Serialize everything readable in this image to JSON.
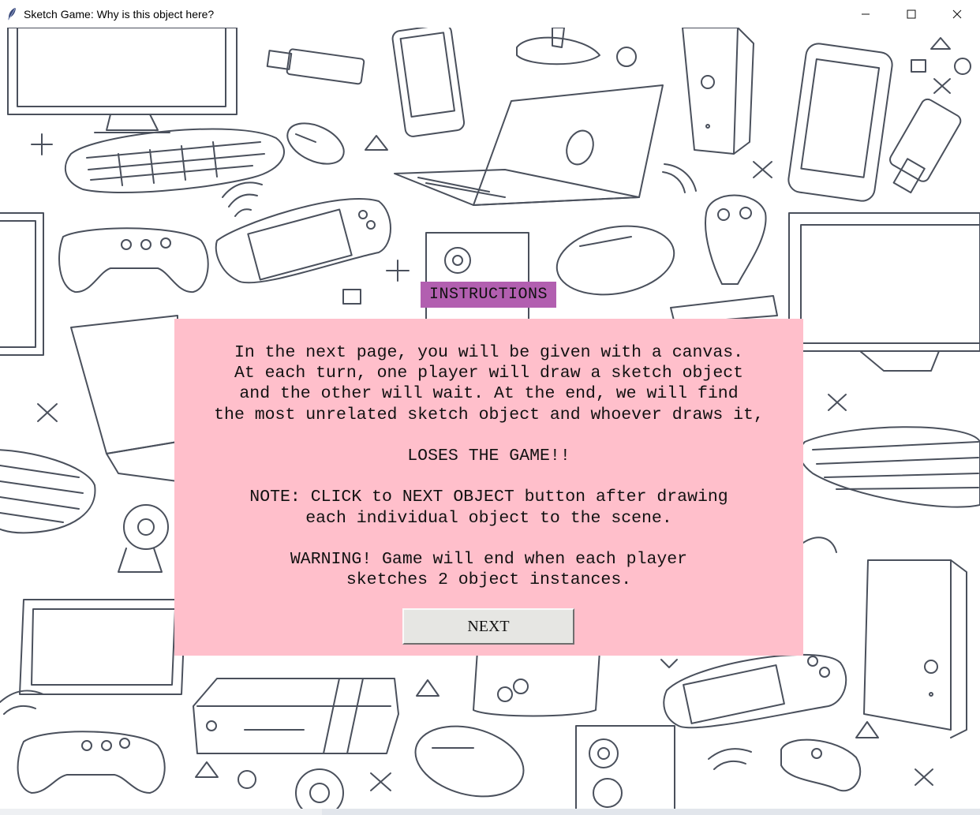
{
  "window": {
    "title": "Sketch Game: Why is this object here?",
    "controls": [
      "minimize",
      "maximize",
      "close"
    ]
  },
  "background": {
    "description_icon": "electronics-doodle-pattern",
    "line_color": "#4a505c"
  },
  "instructions": {
    "heading": "INSTRUCTIONS",
    "heading_bg": "#b25fb0",
    "panel_bg": "#ffbfcb",
    "body": "In the next page, you will be given with a canvas.\nAt each turn, one player will draw a sketch object\nand the other will wait. At the end, we will find\nthe most unrelated sketch object and whoever draws it,\n\nLOSES THE GAME!!\n\nNOTE: CLICK to NEXT OBJECT button after drawing\neach individual object to the scene.\n\nWARNING! Game will end when each player\nsketches 2 object instances.",
    "next_label": "NEXT"
  }
}
